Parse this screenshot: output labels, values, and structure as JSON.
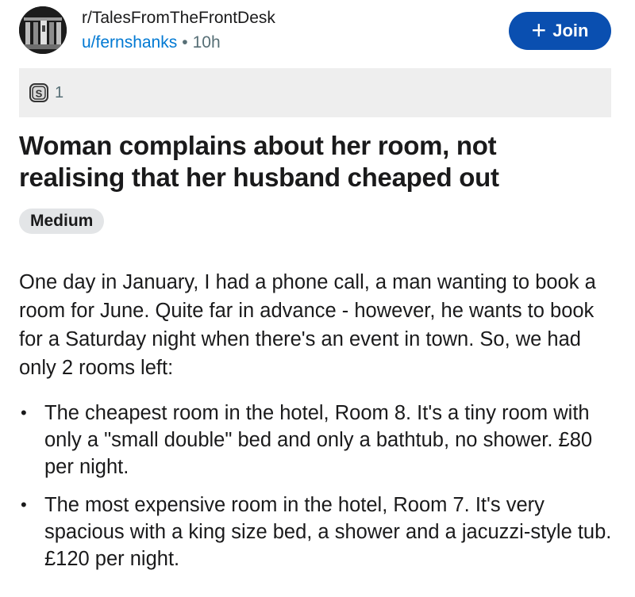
{
  "post_header": {
    "subreddit": "r/TalesFromTheFrontDesk",
    "username": "u/fernshanks",
    "separator": "•",
    "time_ago": "10h",
    "join_label": "Join",
    "join_icon": "plus-icon"
  },
  "awards": {
    "icon": "award-icon",
    "count": "1"
  },
  "post": {
    "title": "Woman complains about her room, not realising that her husband cheaped out",
    "flair": "Medium",
    "body_paragraph": "One day in January, I had a phone call, a man wanting to book a room for June. Quite far in advance - however, he wants to book for a Saturday night when there's an event in town. So, we had only 2 rooms left:",
    "bullets": [
      {
        "marker": "•",
        "text": "The cheapest room in the hotel, Room 8. It's a tiny room with only a \"small double\" bed and only a bathtub, no shower. £80 per night."
      },
      {
        "marker": "•",
        "text": "The most expensive room in the hotel, Room 7. It's very spacious with a king size bed, a shower and a jacuzzi-style tub. £120 per night."
      }
    ]
  },
  "colors": {
    "join_button": "#0a4fb0",
    "username_link": "#0079d3",
    "award_bar_bg": "#eeeeee",
    "flair_bg": "#e3e5e7"
  }
}
